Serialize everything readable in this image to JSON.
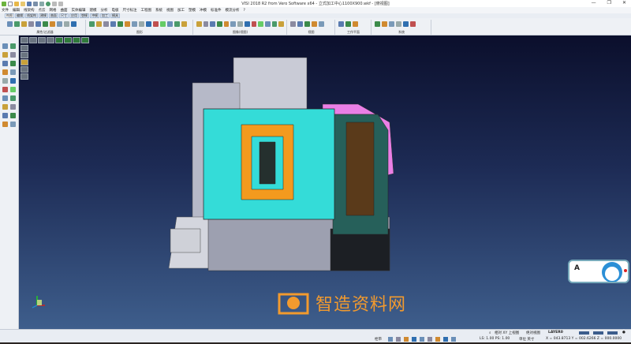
{
  "window": {
    "title": "VISI 2018 R2 from Vero Software x64 - 立式加工中心1100X900.wkf - [俯视图]",
    "minimize": "—",
    "maximize": "❐",
    "close": "✕"
  },
  "menu": [
    "文件",
    "编辑",
    "线架构",
    "点云",
    "网格",
    "曲面",
    "实体编辑",
    "建模",
    "分析",
    "电极",
    "尺寸标注",
    "工程图",
    "系统",
    "视图",
    "加工",
    "塑模",
    "冲模",
    "标准件",
    "模流分析",
    "?"
  ],
  "tabs": [
    "构图",
    "编辑",
    "线架构",
    "建模",
    "曲面",
    "尺寸",
    "应用",
    "塑模",
    "冲模",
    "加工",
    "模具"
  ],
  "ribbon_groups": [
    "属性/过滤器",
    "图形",
    "图像(视图)",
    "视图",
    "工作平面",
    "系统"
  ],
  "watermark": "智造资料网",
  "doraemon": {
    "text": "A"
  },
  "status": {
    "view_relative": "相对 XY 上视图",
    "view_absolute": "绝对视图",
    "layer": "LAYER0",
    "snap": "栓带",
    "scale": "LS: 1.00 PS: 1.00",
    "units": "单位 英寸",
    "coords": "X = 043.8713 Y = 002.6266 Z = 000.0000"
  }
}
